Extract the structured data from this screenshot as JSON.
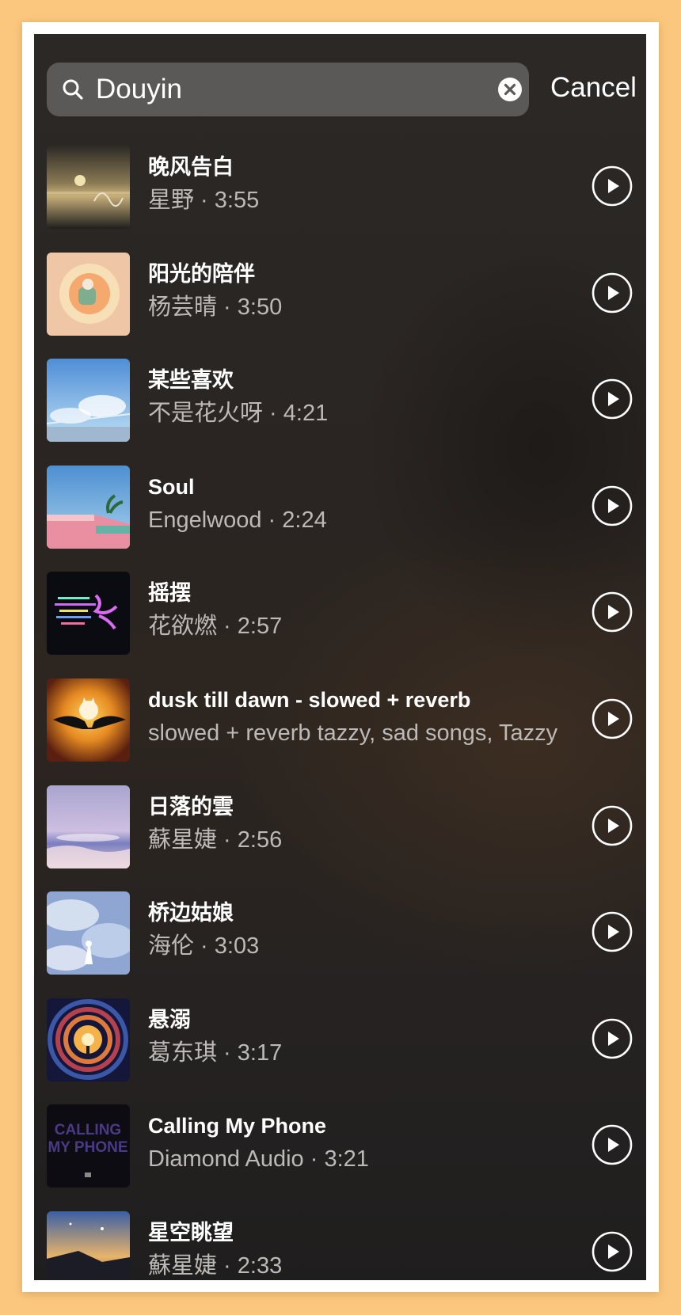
{
  "search": {
    "query": "Douyin",
    "cancel_label": "Cancel"
  },
  "icons": {
    "search": "search-icon",
    "clear": "clear-icon",
    "play": "play-icon"
  },
  "colors": {
    "page_border": "#fbc77e",
    "search_bg": "#5b5957",
    "title_text": "#ffffff",
    "subtitle_text": "#bdb9b6"
  },
  "tracks": [
    {
      "title": "晚风告白",
      "subtitle": "星野 · 3:55",
      "art": "sunset-sea"
    },
    {
      "title": "阳光的陪伴",
      "subtitle": "杨芸晴 · 3:50",
      "art": "sunny-illustration"
    },
    {
      "title": "某些喜欢",
      "subtitle": "不是花火呀 · 4:21",
      "art": "blue-sky"
    },
    {
      "title": "Soul",
      "subtitle": "Engelwood · 2:24",
      "art": "pink-building"
    },
    {
      "title": "摇摆",
      "subtitle": "花欲燃 · 2:57",
      "art": "neon-glitch"
    },
    {
      "title": "dusk till dawn - slowed + reverb",
      "subtitle": "slowed + reverb tazzy, sad songs, Tazzy",
      "art": "winged-cat"
    },
    {
      "title": "日落的雲",
      "subtitle": "蘇星婕 · 2:56",
      "art": "purple-beach"
    },
    {
      "title": "桥边姑娘",
      "subtitle": "海伦 · 3:03",
      "art": "cloud-girl"
    },
    {
      "title": "悬溺",
      "subtitle": "葛东琪 · 3:17",
      "art": "vortex"
    },
    {
      "title": "Calling My Phone",
      "subtitle": "Diamond Audio · 3:21",
      "art": "dark-text",
      "art_text": [
        "CALLING",
        "MY PHONE"
      ]
    },
    {
      "title": "星空眺望",
      "subtitle": "蘇星婕 · 2:33",
      "art": "night-cliff"
    }
  ]
}
